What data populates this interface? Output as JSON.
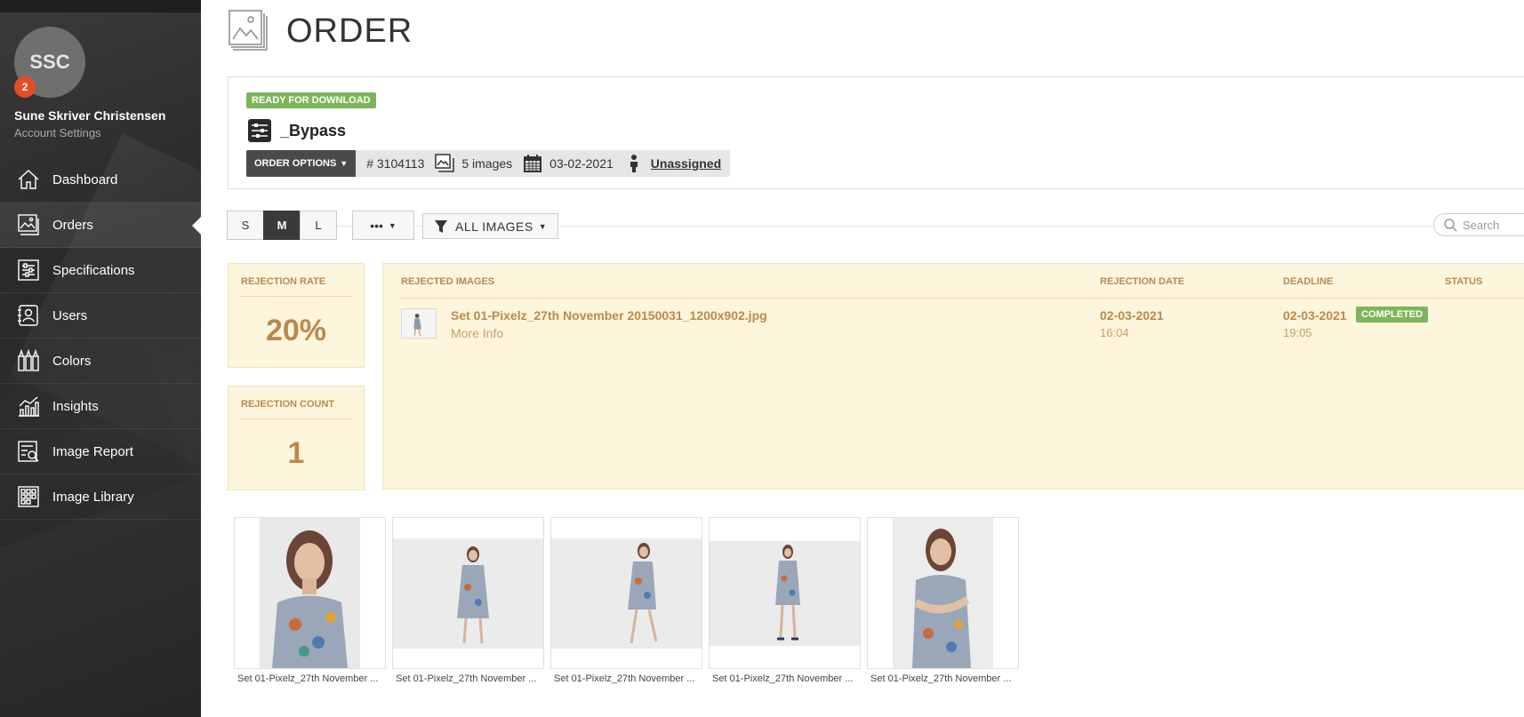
{
  "sidebar": {
    "avatar_initials": "SSC",
    "notification_count": "2",
    "user_name": "Sune Skriver Christensen",
    "account_settings": "Account Settings",
    "items": [
      {
        "label": "Dashboard",
        "icon": "home-icon"
      },
      {
        "label": "Orders",
        "icon": "orders-icon",
        "active": true
      },
      {
        "label": "Specifications",
        "icon": "sliders-icon"
      },
      {
        "label": "Users",
        "icon": "users-icon"
      },
      {
        "label": "Colors",
        "icon": "colors-icon"
      },
      {
        "label": "Insights",
        "icon": "insights-icon"
      },
      {
        "label": "Image Report",
        "icon": "image-report-icon"
      },
      {
        "label": "Image Library",
        "icon": "image-library-icon"
      }
    ]
  },
  "page": {
    "title": "ORDER"
  },
  "order": {
    "status_badge": "READY FOR DOWNLOAD",
    "name": "_Bypass",
    "options_label": "ORDER OPTIONS",
    "number": "# 3104113",
    "images": "5 images",
    "date": "03-02-2021",
    "assignee": "Unassigned"
  },
  "toolbar": {
    "sizes": [
      "S",
      "M",
      "L"
    ],
    "active_size": "M",
    "more_label": "•••",
    "filter_label": "ALL IMAGES",
    "search_placeholder": "Search"
  },
  "stats": {
    "rejection_rate_label": "REJECTION RATE",
    "rejection_rate": "20%",
    "rejection_count_label": "REJECTION COUNT",
    "rejection_count": "1"
  },
  "rejected": {
    "headers": {
      "images": "REJECTED IMAGES",
      "rejection_date": "REJECTION DATE",
      "deadline": "DEADLINE",
      "status": "STATUS"
    },
    "rows": [
      {
        "file": "Set 01-Pixelz_27th November 20150031_1200x902.jpg",
        "more_info": "More Info",
        "rejection_date": "02-03-2021",
        "rejection_time": "16:04",
        "deadline_date": "02-03-2021",
        "deadline_time": "19:05",
        "status": "COMPLETED"
      }
    ]
  },
  "thumbnails": [
    {
      "caption": "Set 01-Pixelz_27th November ...",
      "orientation": "portrait"
    },
    {
      "caption": "Set 01-Pixelz_27th November ...",
      "orientation": "landscape"
    },
    {
      "caption": "Set 01-Pixelz_27th November ...",
      "orientation": "landscape"
    },
    {
      "caption": "Set 01-Pixelz_27th November ...",
      "orientation": "landscape"
    },
    {
      "caption": "Set 01-Pixelz_27th November ...",
      "orientation": "portrait"
    }
  ],
  "colors": {
    "sidebar_bg": "#2e2e2e",
    "accent_green": "#7db65a",
    "rejection_panel": "#fdf5dc",
    "rejection_text": "#b98a4e",
    "notification": "#e44d26"
  }
}
